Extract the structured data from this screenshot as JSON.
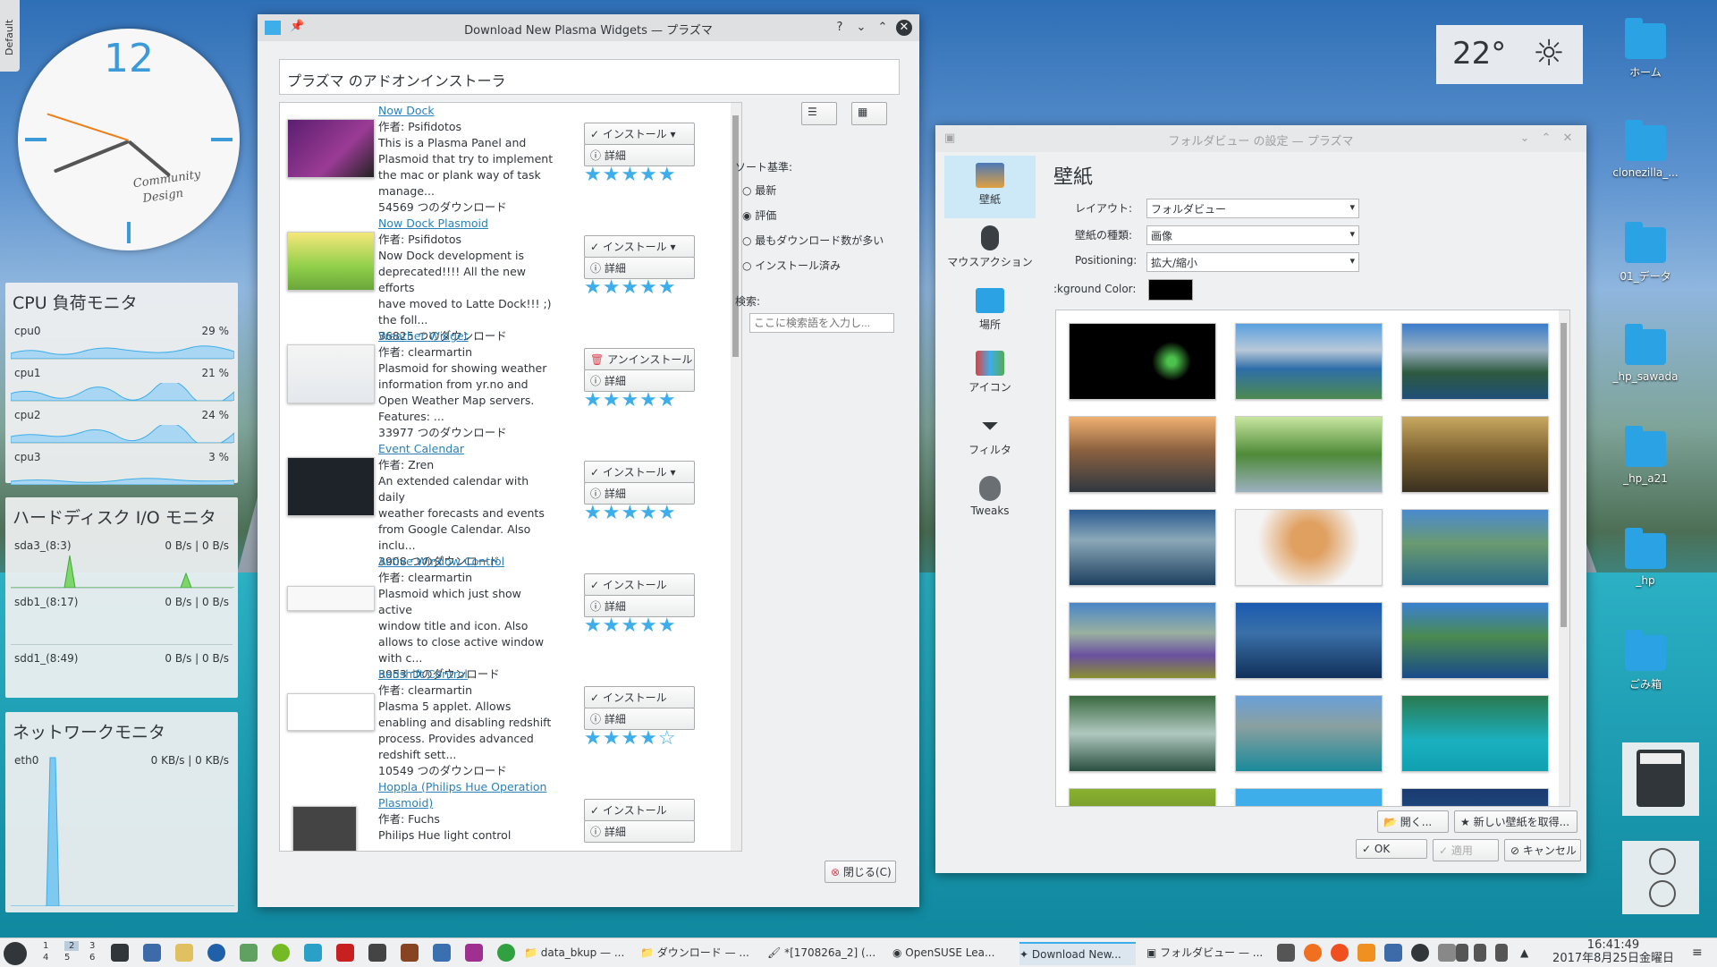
{
  "desktop": {
    "tab_label": "Default",
    "weather_temp": "22°"
  },
  "clock": {
    "hour_label": "12",
    "brand_line1": "Community",
    "brand_line2": "Design"
  },
  "cpu_panel": {
    "title": "CPU 負荷モニタ",
    "rows": [
      {
        "name": "cpu0",
        "value": "29 %"
      },
      {
        "name": "cpu1",
        "value": "21 %"
      },
      {
        "name": "cpu2",
        "value": "24 %"
      },
      {
        "name": "cpu3",
        "value": "3 %"
      }
    ]
  },
  "disk_panel": {
    "title": "ハードディスク I/O モニタ",
    "rows": [
      {
        "name": "sda3_(8:3)",
        "value": "0 B/s | 0 B/s"
      },
      {
        "name": "sdb1_(8:17)",
        "value": "0 B/s | 0 B/s"
      },
      {
        "name": "sdd1_(8:49)",
        "value": "0 B/s | 0 B/s"
      }
    ]
  },
  "net_panel": {
    "title": "ネットワークモニタ",
    "rows": [
      {
        "name": "eth0",
        "value": "0 KB/s | 0 KB/s"
      }
    ]
  },
  "download_window": {
    "title": "Download New Plasma Widgets — プラズマ",
    "header": "プラズマ のアドオンインストーラ",
    "sort_label": "ソート基準:",
    "sort_options": [
      "最新",
      "評価",
      "最もダウンロード数が多い",
      "インストール済み"
    ],
    "search_label": "検索:",
    "search_placeholder": "ここに検索語を入力し...",
    "close_label": "閉じる(C)",
    "install_label": "インストール",
    "uninstall_label": "アンインストール",
    "details_label": "詳細",
    "items": [
      {
        "name": "Now Dock",
        "author": "作者: Psifidotos",
        "desc": [
          "This is a Plasma Panel and",
          "Plasmoid that try to implement",
          "the mac or plank way of task",
          "manage..."
        ],
        "downloads": "54569 つのダウンロード",
        "rating": 5
      },
      {
        "name": "Now Dock Plasmoid",
        "author": "作者: Psifidotos",
        "desc": [
          "Now Dock development is",
          "deprecated!!!! All the new efforts",
          "have moved to Latte Dock!!! ;)",
          "the foll..."
        ],
        "downloads": "36825 つのダウンロード",
        "rating": 5
      },
      {
        "name": "Weather Widget",
        "author": "作者: clearmartin",
        "desc": [
          "Plasmoid for showing weather",
          "information from yr.no and",
          "Open Weather Map servers.",
          "Features: ..."
        ],
        "downloads": "33977 つのダウンロード",
        "rating": 5
      },
      {
        "name": "Event Calendar",
        "author": "作者: Zren",
        "desc": [
          "An extended calendar with daily",
          "weather forecasts and events",
          "from Google Calendar. Also",
          "inclu..."
        ],
        "downloads": "3908 つのダウンロード",
        "rating": 5
      },
      {
        "name": "Active Window Control",
        "author": "作者: clearmartin",
        "desc": [
          "Plasmoid which just show active",
          "window title and icon. Also",
          "allows to close active window",
          "with c..."
        ],
        "downloads": "3953 つのダウンロード",
        "rating": 5
      },
      {
        "name": "Redshift Control",
        "author": "作者: clearmartin",
        "desc": [
          "Plasma 5 applet. Allows",
          "enabling and disabling redshift",
          "process. Provides advanced",
          "redshift sett..."
        ],
        "downloads": "10549 つのダウンロード",
        "rating": 4.5
      },
      {
        "name": "Hoppla (Philips Hue Operation Plasmoid)",
        "author": "作者: Fuchs",
        "desc": [
          "Philips Hue light control"
        ],
        "downloads": "",
        "rating": 0
      }
    ]
  },
  "folder_window": {
    "title": "フォルダビュー の設定 — プラズマ",
    "heading": "壁紙",
    "sidebar": [
      "壁紙",
      "マウスアクション",
      "場所",
      "アイコン",
      "フィルタ",
      "Tweaks"
    ],
    "layout_label": "レイアウト:",
    "layout_value": "フォルダビュー",
    "type_label": "壁紙の種類:",
    "type_value": "画像",
    "position_label": "Positioning:",
    "position_value": "拡大/縮小",
    "bg_label": ":kground Color:",
    "open_label": "開く...",
    "get_new_label": "新しい壁紙を取得...",
    "ok_label": "OK",
    "apply_label": "適用",
    "cancel_label": "キャンセル"
  },
  "desktop_icons": [
    "ホーム",
    "clonezilla_...",
    "01_データ",
    "_hp_sawada",
    "_hp_a21",
    "_hp",
    "ごみ箱"
  ],
  "taskbar": {
    "pager": [
      "1",
      "2",
      "3",
      "4",
      "5",
      "6"
    ],
    "tasks": [
      "data_bkup — ...",
      "ダウンロード — ...",
      "*[170826a_2] (...",
      "OpenSUSE Lea...",
      "Download New...",
      "フォルダビュー — ..."
    ],
    "time": "16:41:49",
    "date": "2017年8月25日金曜日"
  }
}
